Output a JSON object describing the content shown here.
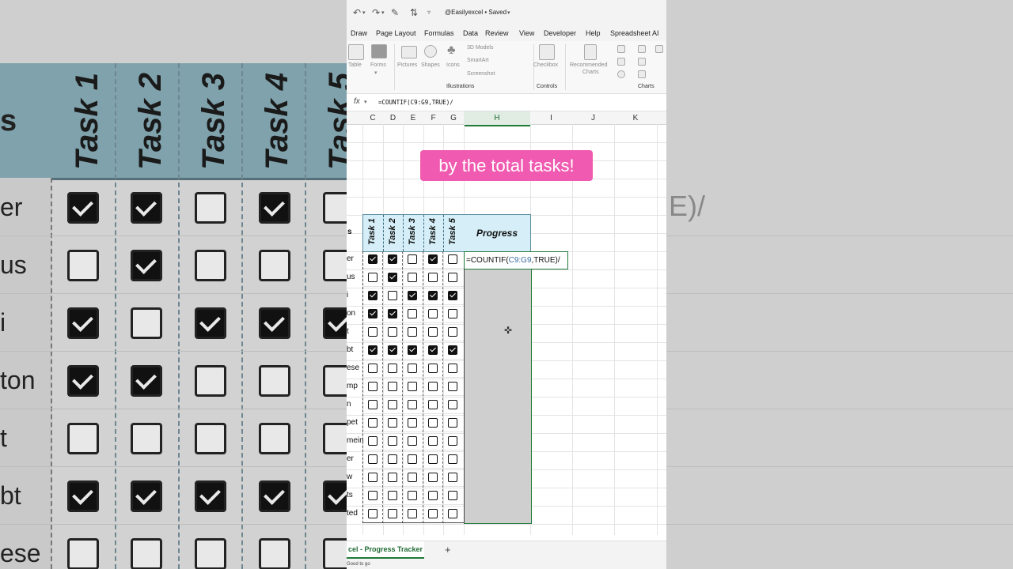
{
  "title_bar": {
    "doc_title": "@Easilyexcel • Saved"
  },
  "menu": [
    "Draw",
    "Page Layout",
    "Formulas",
    "Data",
    "Review",
    "View",
    "Developer",
    "Help",
    "Spreadsheet AI"
  ],
  "ribbon": {
    "items": {
      "table": "Table",
      "forms": "Forms",
      "pictures": "Pictures",
      "shapes": "Shapes",
      "icons": "Icons",
      "models_3d": "3D Models",
      "smartart": "SmartArt",
      "screenshot": "Screenshot",
      "checkbox": "Checkbox",
      "recommended_charts_1": "Recommended",
      "recommended_charts_2": "Charts"
    },
    "groups": {
      "illustrations": "Illustrations",
      "controls": "Controls",
      "charts": "Charts"
    }
  },
  "formula_bar": {
    "fx": "fx",
    "formula": "=COUNTIF(C9:G9,TRUE)/"
  },
  "columns": [
    "C",
    "D",
    "E",
    "F",
    "G",
    "H",
    "I",
    "J",
    "K"
  ],
  "selected_column": "H",
  "banner": "by the total tasks!",
  "table": {
    "header_left": "s",
    "tasks": [
      "Task 1",
      "Task 2",
      "Task 3",
      "Task 4",
      "Task 5"
    ],
    "progress_header": "Progress",
    "rows": [
      {
        "name": "er",
        "checks": [
          true,
          true,
          false,
          true,
          false
        ]
      },
      {
        "name": "us",
        "checks": [
          false,
          true,
          false,
          false,
          false
        ]
      },
      {
        "name": "i",
        "checks": [
          true,
          false,
          true,
          true,
          true
        ]
      },
      {
        "name": "on",
        "checks": [
          true,
          true,
          false,
          false,
          false
        ]
      },
      {
        "name": "t",
        "checks": [
          false,
          false,
          false,
          false,
          false
        ]
      },
      {
        "name": "bt",
        "checks": [
          true,
          true,
          true,
          true,
          true
        ]
      },
      {
        "name": "ese",
        "checks": [
          false,
          false,
          false,
          false,
          false
        ]
      },
      {
        "name": "mp",
        "checks": [
          false,
          false,
          false,
          false,
          false
        ]
      },
      {
        "name": "n",
        "checks": [
          false,
          false,
          false,
          false,
          false
        ]
      },
      {
        "name": "pet",
        "checks": [
          false,
          false,
          false,
          false,
          false
        ]
      },
      {
        "name": "mein",
        "checks": [
          false,
          false,
          false,
          false,
          false
        ]
      },
      {
        "name": "er",
        "checks": [
          false,
          false,
          false,
          false,
          false
        ]
      },
      {
        "name": "w",
        "checks": [
          false,
          false,
          false,
          false,
          false
        ]
      },
      {
        "name": "ts",
        "checks": [
          false,
          false,
          false,
          false,
          false
        ]
      },
      {
        "name": "ted",
        "checks": [
          false,
          false,
          false,
          false,
          false
        ]
      }
    ]
  },
  "active_cell": {
    "prefix": "=COUNTIF(",
    "ref": "C9:G9",
    "suffix": ",TRUE)/"
  },
  "sheet_tab": "cel - Progress Tracker",
  "add_sheet": "+",
  "status": "Good to go",
  "background_zoom": {
    "tasks": [
      "Task 1",
      "Task 2",
      "Task 3",
      "Task 4",
      "Task 5"
    ],
    "header_left": "s",
    "rows": [
      {
        "name": "er",
        "checks": [
          true,
          true,
          false,
          true,
          false
        ]
      },
      {
        "name": "us",
        "checks": [
          false,
          true,
          false,
          false,
          false
        ]
      },
      {
        "name": "i",
        "checks": [
          true,
          false,
          true,
          true,
          true
        ]
      },
      {
        "name": "ton",
        "checks": [
          true,
          true,
          false,
          false,
          false
        ]
      },
      {
        "name": "t",
        "checks": [
          false,
          false,
          false,
          false,
          false
        ]
      },
      {
        "name": "bt",
        "checks": [
          true,
          true,
          true,
          true,
          true
        ]
      },
      {
        "name": "ese",
        "checks": [
          false,
          false,
          false,
          false,
          false
        ]
      }
    ],
    "right_text": "E)/"
  }
}
